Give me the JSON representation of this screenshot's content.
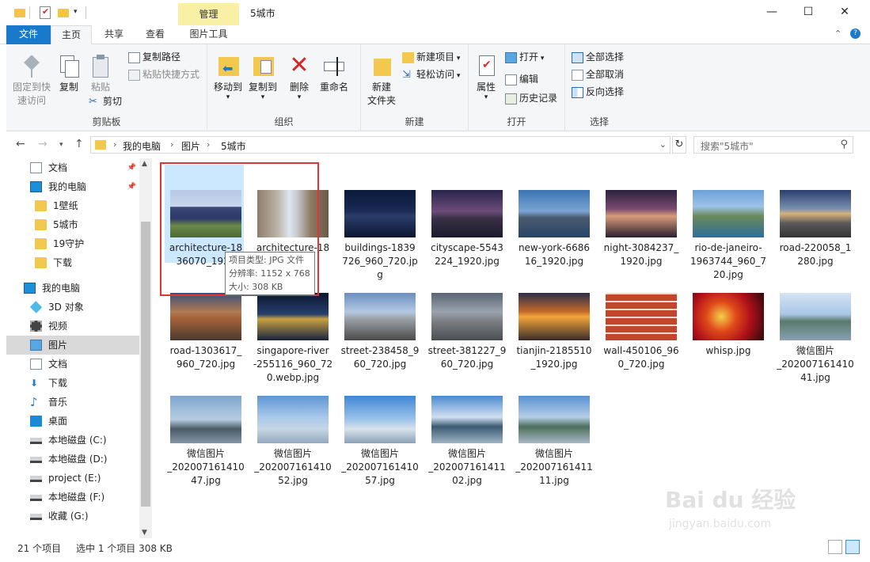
{
  "window": {
    "context_tab": "管理",
    "title": "5城市",
    "min_glyph": "—",
    "max_glyph": "☐",
    "close_glyph": "✕"
  },
  "tabs": {
    "file": "文件",
    "home": "主页",
    "share": "共享",
    "view": "查看",
    "picture_tools": "图片工具"
  },
  "ribbon": {
    "pin": "固定到快速访问",
    "pin_l1": "固定到快",
    "pin_l2": "速访问",
    "copy": "复制",
    "paste": "粘贴",
    "copy_path": "复制路径",
    "paste_shortcut": "粘贴快捷方式",
    "cut": "剪切",
    "clipboard_group": "剪贴板",
    "move_to": "移动到",
    "copy_to": "复制到",
    "delete": "删除",
    "rename": "重命名",
    "organize_group": "组织",
    "new_folder_l1": "新建",
    "new_folder_l2": "文件夹",
    "new_item": "新建项目",
    "easy_access": "轻松访问",
    "new_group": "新建",
    "properties": "属性",
    "open": "打开",
    "edit": "编辑",
    "history": "历史记录",
    "open_group": "打开",
    "select_all": "全部选择",
    "select_none": "全部取消",
    "invert_selection": "反向选择",
    "select_group": "选择"
  },
  "address": {
    "crumbs": [
      "我的电脑",
      "图片",
      "5城市"
    ],
    "search_placeholder": "搜索\"5城市\""
  },
  "nav": {
    "items": [
      {
        "label": "文档",
        "icon": "document-icon",
        "pinned": true
      },
      {
        "label": "我的电脑",
        "icon": "computer-icon",
        "pinned": true
      },
      {
        "label": "1壁纸",
        "icon": "folder-icon"
      },
      {
        "label": "5城市",
        "icon": "folder-icon"
      },
      {
        "label": "19守护",
        "icon": "folder-icon"
      },
      {
        "label": "下载",
        "icon": "folder-icon"
      },
      {
        "label": "我的电脑",
        "icon": "computer-icon"
      },
      {
        "label": "3D 对象",
        "icon": "cube-icon"
      },
      {
        "label": "视频",
        "icon": "video-icon"
      },
      {
        "label": "图片",
        "icon": "pictures-icon",
        "selected": true
      },
      {
        "label": "文档",
        "icon": "document-icon"
      },
      {
        "label": "下载",
        "icon": "download-icon"
      },
      {
        "label": "音乐",
        "icon": "music-icon"
      },
      {
        "label": "桌面",
        "icon": "desktop-icon"
      },
      {
        "label": "本地磁盘 (C:)",
        "icon": "drive-icon"
      },
      {
        "label": "本地磁盘 (D:)",
        "icon": "drive-icon"
      },
      {
        "label": "project (E:)",
        "icon": "drive-icon"
      },
      {
        "label": "本地磁盘 (F:)",
        "icon": "drive-icon"
      },
      {
        "label": "收藏 (G:)",
        "icon": "drive-icon"
      }
    ]
  },
  "files": [
    {
      "name": "architecture-1836070_1920.jpg",
      "shown": "architecture-18\n36070_1920",
      "selected": true
    },
    {
      "name": "architecture-18…jpg",
      "shown": "architecture-18\njpg"
    },
    {
      "name": "buildings-1839726_960_720.jpg",
      "shown": "buildings-1839\n726_960_720.jp\ng"
    },
    {
      "name": "cityscape-5543224_1920.jpg",
      "shown": "cityscape-5543\n224_1920.jpg"
    },
    {
      "name": "new-york-668616_1920.jpg",
      "shown": "new-york-6686\n16_1920.jpg"
    },
    {
      "name": "night-3084237_1920.jpg",
      "shown": "night-3084237_\n1920.jpg"
    },
    {
      "name": "rio-de-janeiro-1963744_960_720.jpg",
      "shown": "rio-de-janeiro-\n1963744_960_7\n20.jpg"
    },
    {
      "name": "road-220058_1280.jpg",
      "shown": "road-220058_1\n280.jpg"
    },
    {
      "name": "road-1303617_960_720.jpg",
      "shown": "road-1303617_\n960_720.jpg"
    },
    {
      "name": "singapore-river-255116_960_720.webp.jpg",
      "shown": "singapore-river\n-255116_960_72\n0.webp.jpg"
    },
    {
      "name": "street-238458_960_720.jpg",
      "shown": "street-238458_9\n60_720.jpg"
    },
    {
      "name": "street-381227_960_720.jpg",
      "shown": "street-381227_9\n60_720.jpg"
    },
    {
      "name": "tianjin-2185510_1920.jpg",
      "shown": "tianjin-2185510\n_1920.jpg"
    },
    {
      "name": "wall-450106_960_720.jpg",
      "shown": "wall-450106_96\n0_720.jpg"
    },
    {
      "name": "whisp.jpg",
      "shown": "whisp.jpg"
    },
    {
      "name": "微信图片_20200716141041.jpg",
      "shown": "微信图片\n_202007161410\n41.jpg"
    },
    {
      "name": "微信图片_20200716141047.jpg",
      "shown": "微信图片\n_202007161410\n47.jpg"
    },
    {
      "name": "微信图片_20200716141052.jpg",
      "shown": "微信图片\n_202007161410\n52.jpg"
    },
    {
      "name": "微信图片_20200716141057.jpg",
      "shown": "微信图片\n_202007161410\n57.jpg"
    },
    {
      "name": "微信图片_20200716141102.jpg",
      "shown": "微信图片\n_202007161411\n02.jpg"
    },
    {
      "name": "微信图片_20200716141111.jpg",
      "shown": "微信图片\n_202007161411\n11.jpg"
    }
  ],
  "tooltip": {
    "type": "项目类型: JPG 文件",
    "resolution": "分辨率: 1152 x 768",
    "size": "大小: 308 KB"
  },
  "status": {
    "count": "21 个项目",
    "selection": "选中 1 个项目  308 KB"
  },
  "watermark": {
    "line1": "Bai du 经验",
    "line2": "jingyan.baidu.com"
  },
  "colors": {
    "accent": "#1979ca",
    "selection": "#cce8ff",
    "highlight_box": "#e23434"
  }
}
